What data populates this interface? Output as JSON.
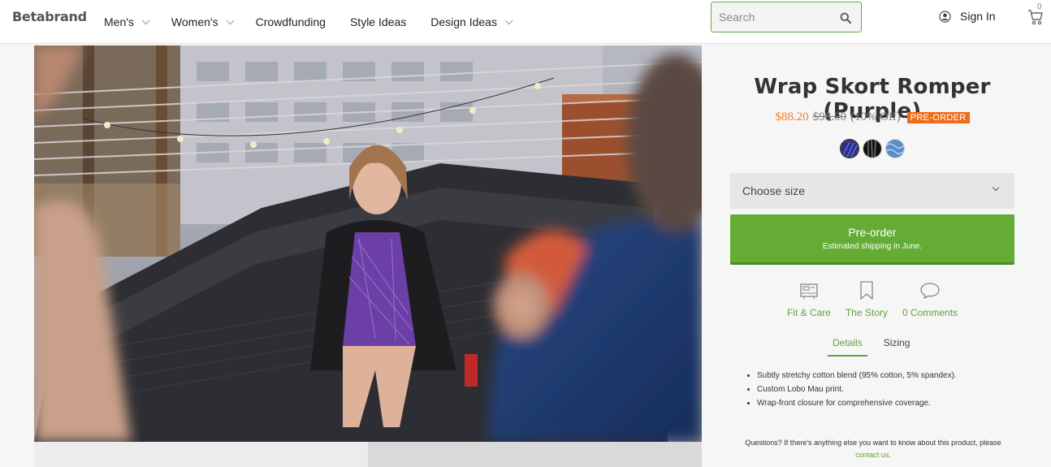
{
  "header": {
    "logo": "Betabrand",
    "nav": [
      {
        "label": "Men's",
        "has_dropdown": true
      },
      {
        "label": "Women's",
        "has_dropdown": true
      },
      {
        "label": "Crowdfunding",
        "has_dropdown": false
      },
      {
        "label": "Style Ideas",
        "has_dropdown": false
      },
      {
        "label": "Design Ideas",
        "has_dropdown": true
      }
    ],
    "search": {
      "placeholder": "Search",
      "value": ""
    },
    "signin_label": "Sign In",
    "cart_count": "0"
  },
  "product": {
    "title": "Wrap Skort Romper (Purple)",
    "price_sale": "$88.20",
    "price_original": "$98.00",
    "price_discount": "(10% Off)",
    "badge": "PRE-ORDER",
    "swatches": [
      "purple-stripe",
      "black-stripe",
      "blue-tie-dye"
    ],
    "size_select": {
      "selected": "Choose size"
    },
    "preorder_button": {
      "label": "Pre-order",
      "sub": "Estimated shipping in June."
    },
    "links": [
      {
        "label": "Fit & Care",
        "icon": "sewing-machine-icon"
      },
      {
        "label": "The Story",
        "icon": "bookmark-icon"
      },
      {
        "label": "0 Comments",
        "icon": "speech-bubble-icon"
      }
    ],
    "tabs": [
      {
        "label": "Details",
        "active": true
      },
      {
        "label": "Sizing",
        "active": false
      }
    ],
    "details": [
      "Subtly stretchy cotton blend (95% cotton, 5% spandex).",
      "Custom Lobo Mau print.",
      "Wrap-front closure for comprehensive coverage."
    ],
    "questions_text": "Questions? If there's anything else you want to know about this product, please",
    "contact_link": "contact us",
    "contact_suffix": "."
  },
  "colors": {
    "accent_green": "#64ac35",
    "link_green": "#5ba53a",
    "sale_orange": "#ef7c28",
    "badge_orange": "#ef6c1a"
  }
}
